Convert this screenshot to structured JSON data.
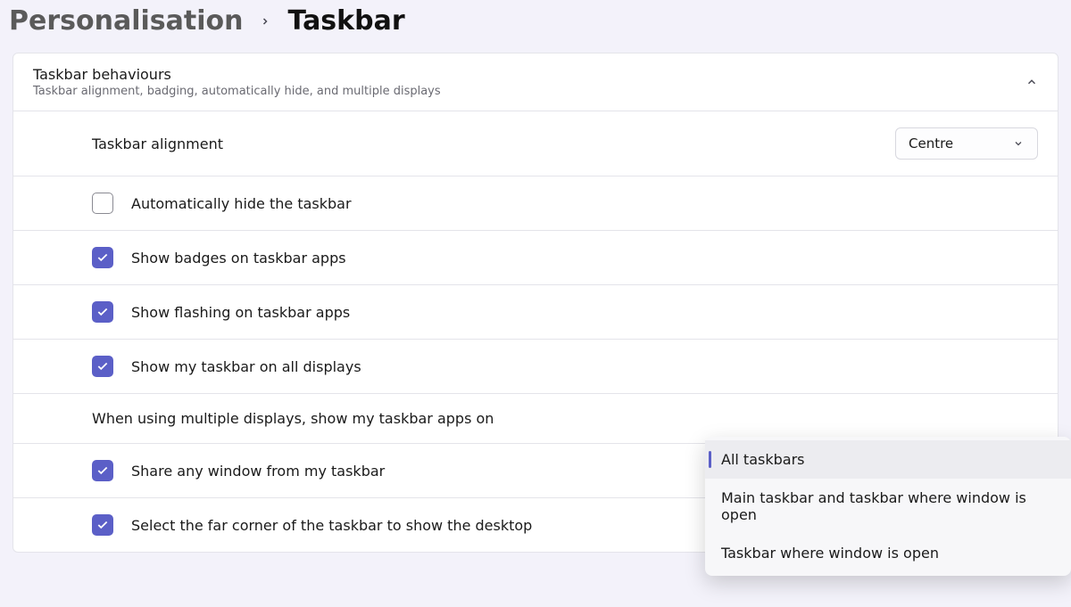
{
  "breadcrumb": {
    "parent": "Personalisation",
    "current": "Taskbar"
  },
  "section": {
    "title": "Taskbar behaviours",
    "subtitle": "Taskbar alignment, badging, automatically hide, and multiple displays"
  },
  "rows": {
    "alignment": {
      "label": "Taskbar alignment",
      "value": "Centre"
    },
    "auto_hide": {
      "label": "Automatically hide the taskbar",
      "checked": false
    },
    "show_badges": {
      "label": "Show badges on taskbar apps",
      "checked": true
    },
    "show_flashing": {
      "label": "Show flashing on taskbar apps",
      "checked": true
    },
    "all_displays": {
      "label": "Show my taskbar on all displays",
      "checked": true
    },
    "multi_apps": {
      "label": "When using multiple displays, show my taskbar apps on"
    },
    "share_window": {
      "label": "Share any window from my taskbar",
      "checked": true
    },
    "far_corner": {
      "label": "Select the far corner of the taskbar to show the desktop",
      "checked": true
    }
  },
  "dropdown": {
    "items": [
      {
        "label": "All taskbars",
        "selected": true
      },
      {
        "label": "Main taskbar and taskbar where window is open",
        "selected": false
      },
      {
        "label": "Taskbar where window is open",
        "selected": false
      }
    ]
  }
}
